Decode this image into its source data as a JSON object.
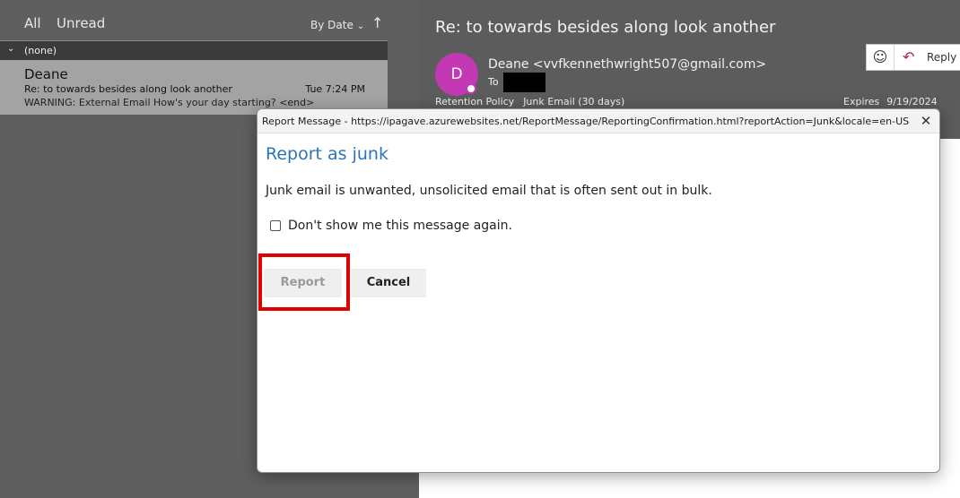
{
  "list_pane": {
    "tabs": [
      "All",
      "Unread"
    ],
    "sort_label": "By Date",
    "sort_chevron": "⌄",
    "sort_direction_icon": "↑",
    "group": {
      "label": "(none)"
    },
    "items": [
      {
        "sender": "Deane",
        "subject": "Re: to towards besides along look another",
        "time": "Tue 7:24 PM",
        "preview": "WARNING: External Email   How's your day starting? <end>"
      }
    ]
  },
  "reading_pane": {
    "subject": "Re: to towards besides along look another",
    "avatar_initial": "D",
    "from": "Deane <vvfkennethwright507@gmail.com>",
    "to_label": "To",
    "retention_label": "Retention Policy",
    "retention_value": "Junk Email (30 days)",
    "expires_label": "Expires",
    "expires_value": "9/19/2024",
    "actions": {
      "emoji_icon": "☺",
      "reply_icon": "↶",
      "reply_label": "Reply"
    }
  },
  "dialog": {
    "title": "Report Message - https://ipagave.azurewebsites.net/ReportMessage/ReportingConfirmation.html?reportAction=Junk&locale=en-US&_...",
    "heading": "Report as junk",
    "body": "Junk email is unwanted, unsolicited email that is often sent out in bulk.",
    "checkbox_label": "Don't show me this message again.",
    "report_label": "Report",
    "cancel_label": "Cancel",
    "close_icon": "✕"
  },
  "colors": {
    "avatar": "#c239b3",
    "heading": "#2e74b5",
    "highlight": "#e00000"
  }
}
